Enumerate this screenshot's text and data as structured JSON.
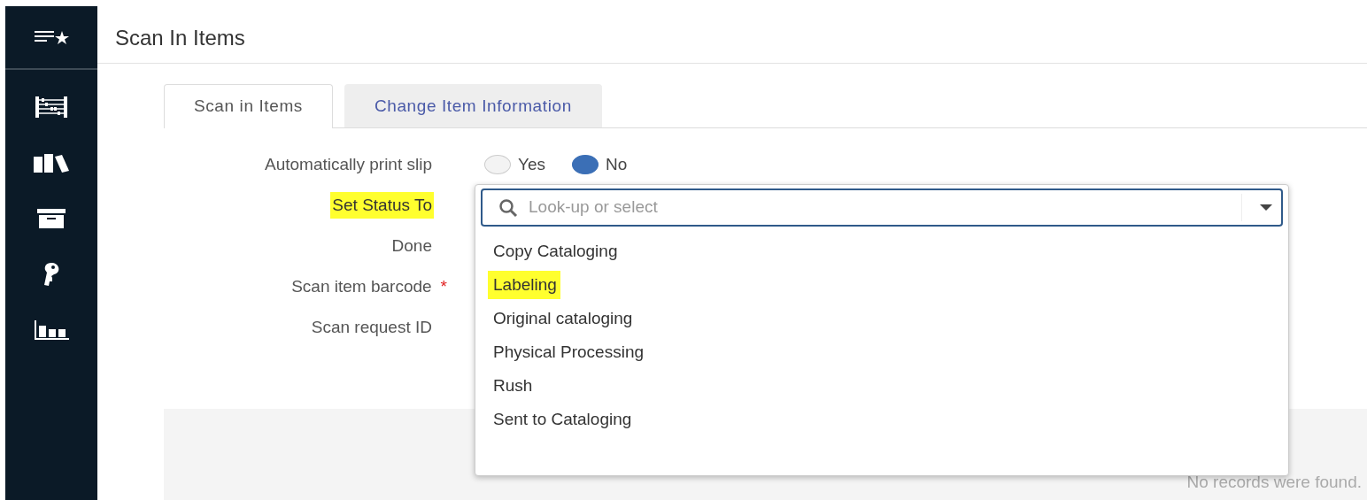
{
  "sidebar": {
    "items": [
      {
        "kind": "star-list"
      },
      {
        "kind": "abacus"
      },
      {
        "kind": "books"
      },
      {
        "kind": "box"
      },
      {
        "kind": "key"
      },
      {
        "kind": "chart"
      }
    ]
  },
  "page": {
    "title": "Scan In Items"
  },
  "tabs": [
    {
      "label": "Scan in Items",
      "selected": true
    },
    {
      "label": "Change Item Information",
      "selected": false
    }
  ],
  "form": {
    "fields": [
      {
        "label": "Automatically print slip",
        "highlighted": false,
        "kind": "radio",
        "options": [
          {
            "label": "Yes",
            "selected": false
          },
          {
            "label": "No",
            "selected": true
          }
        ]
      },
      {
        "label": "Set Status To",
        "highlighted": true,
        "kind": "select"
      },
      {
        "label": "Done",
        "highlighted": false,
        "kind": "plain"
      },
      {
        "label": "Scan item barcode",
        "required_mark": "*",
        "highlighted": false,
        "kind": "plain"
      },
      {
        "label": "Scan request ID",
        "highlighted": false,
        "kind": "plain"
      }
    ]
  },
  "dropdown": {
    "placeholder": "Look-up or select",
    "options": [
      {
        "label": "Copy Cataloging",
        "highlighted": false
      },
      {
        "label": "Labeling",
        "highlighted": true
      },
      {
        "label": "Original cataloging",
        "highlighted": false
      },
      {
        "label": "Physical Processing",
        "highlighted": false
      },
      {
        "label": "Rush",
        "highlighted": false
      },
      {
        "label": "Sent to Cataloging",
        "highlighted": false
      }
    ]
  },
  "results": {
    "empty_message": "No records were found."
  }
}
